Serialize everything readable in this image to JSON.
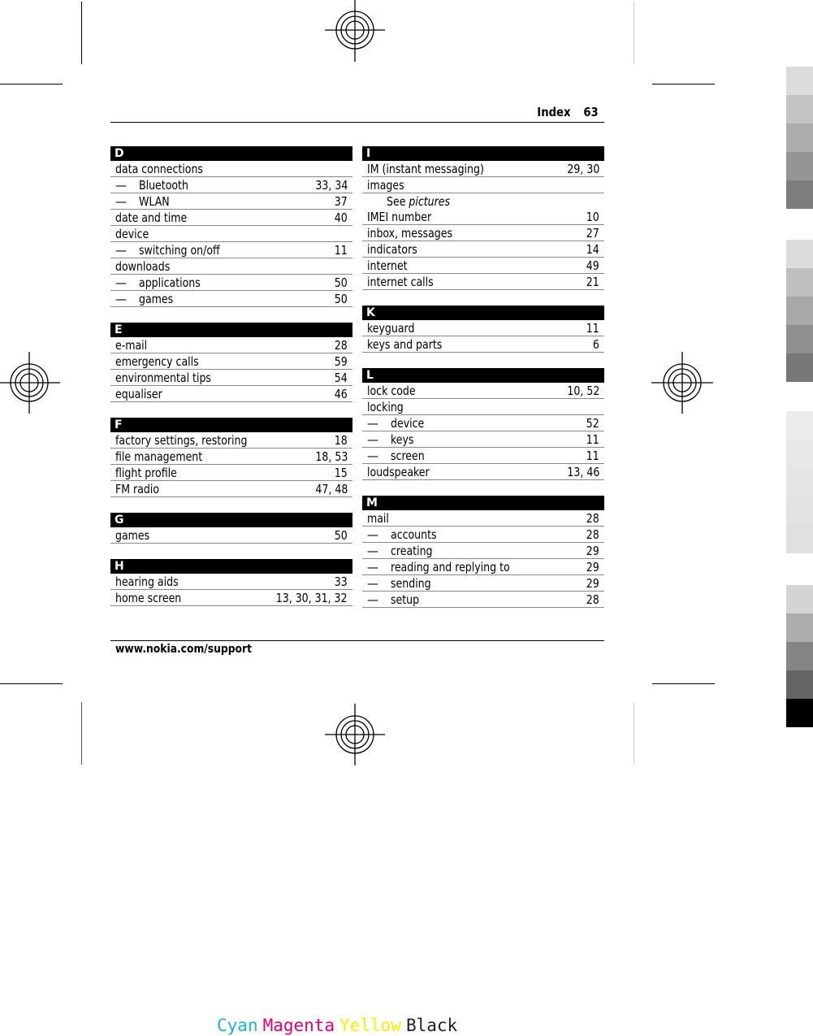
{
  "header": {
    "section": "Index",
    "page_number": "63"
  },
  "footer": {
    "url": "www.nokia.com/support"
  },
  "columns": [
    {
      "sections": [
        {
          "letter": "D",
          "entries": [
            {
              "term": "data connections",
              "pages": "",
              "level": 0
            },
            {
              "term": "Bluetooth",
              "pages": "33, 34",
              "level": 1
            },
            {
              "term": "WLAN",
              "pages": "37",
              "level": 1
            },
            {
              "term": "date and time",
              "pages": "40",
              "level": 0
            },
            {
              "term": "device",
              "pages": "",
              "level": 0
            },
            {
              "term": "switching on/off",
              "pages": "11",
              "level": 1
            },
            {
              "term": "downloads",
              "pages": "",
              "level": 0
            },
            {
              "term": "applications",
              "pages": "50",
              "level": 1
            },
            {
              "term": "games",
              "pages": "50",
              "level": 1
            }
          ]
        },
        {
          "letter": "E",
          "entries": [
            {
              "term": "e-mail",
              "pages": "28",
              "level": 0
            },
            {
              "term": "emergency calls",
              "pages": "59",
              "level": 0
            },
            {
              "term": "environmental tips",
              "pages": "54",
              "level": 0
            },
            {
              "term": "equaliser",
              "pages": "46",
              "level": 0
            }
          ]
        },
        {
          "letter": "F",
          "entries": [
            {
              "term": "factory settings, restoring",
              "pages": "18",
              "level": 0
            },
            {
              "term": "file management",
              "pages": "18, 53",
              "level": 0
            },
            {
              "term": "flight profile",
              "pages": "15",
              "level": 0
            },
            {
              "term": "FM radio",
              "pages": "47, 48",
              "level": 0
            }
          ]
        },
        {
          "letter": "G",
          "entries": [
            {
              "term": "games",
              "pages": "50",
              "level": 0
            }
          ]
        },
        {
          "letter": "H",
          "entries": [
            {
              "term": "hearing aids",
              "pages": "33",
              "level": 0
            },
            {
              "term": "home screen",
              "pages": "13, 30, 31, 32",
              "level": 0
            }
          ]
        }
      ]
    },
    {
      "sections": [
        {
          "letter": "I",
          "entries": [
            {
              "term": "IM (instant messaging)",
              "pages": "29, 30",
              "level": 0
            },
            {
              "term": "images",
              "pages": "",
              "level": 0
            },
            {
              "term": "See",
              "see_target": "pictures",
              "pages": "",
              "level": "see"
            },
            {
              "term": "IMEI number",
              "pages": "10",
              "level": 0
            },
            {
              "term": "inbox, messages",
              "pages": "27",
              "level": 0
            },
            {
              "term": "indicators",
              "pages": "14",
              "level": 0
            },
            {
              "term": "internet",
              "pages": "49",
              "level": 0
            },
            {
              "term": "internet calls",
              "pages": "21",
              "level": 0
            }
          ]
        },
        {
          "letter": "K",
          "entries": [
            {
              "term": "keyguard",
              "pages": "11",
              "level": 0
            },
            {
              "term": "keys and parts",
              "pages": "6",
              "level": 0
            }
          ]
        },
        {
          "letter": "L",
          "entries": [
            {
              "term": "lock code",
              "pages": "10, 52",
              "level": 0
            },
            {
              "term": "locking",
              "pages": "",
              "level": 0
            },
            {
              "term": "device",
              "pages": "52",
              "level": 1
            },
            {
              "term": "keys",
              "pages": "11",
              "level": 1
            },
            {
              "term": "screen",
              "pages": "11",
              "level": 1
            },
            {
              "term": "loudspeaker",
              "pages": "13, 46",
              "level": 0
            }
          ]
        },
        {
          "letter": "M",
          "entries": [
            {
              "term": "mail",
              "pages": "28",
              "level": 0
            },
            {
              "term": "accounts",
              "pages": "28",
              "level": 1
            },
            {
              "term": "creating",
              "pages": "29",
              "level": 1
            },
            {
              "term": "reading and replying to",
              "pages": "29",
              "level": 1
            },
            {
              "term": "sending",
              "pages": "29",
              "level": 1
            },
            {
              "term": "setup",
              "pages": "28",
              "level": 1
            }
          ]
        }
      ]
    }
  ],
  "sub_entry_marker": "—",
  "print_marks": {
    "color_bar_top": [
      "#dcdcdc",
      "#c4c4c4",
      "#acacac",
      "#959595",
      "#7d7d7d"
    ],
    "color_bar_mid": [
      "#dcdcdc",
      "#bfbfbf",
      "#a8a8a8",
      "#8f8f8f",
      "#777777"
    ],
    "color_bar_light": [
      "#ececec",
      "#e8e8e8",
      "#e5e5e5",
      "#e3e3e3",
      "#e0e0e0"
    ],
    "color_bar_bottom": [
      "#d4d4d4",
      "#adadad",
      "#858585",
      "#646464",
      "#000000"
    ],
    "separations": [
      {
        "label": "Cyan",
        "color": "#1ab2e8"
      },
      {
        "label": "Magenta",
        "color": "#e5007e"
      },
      {
        "label": "Yellow",
        "color": "#ffed00"
      },
      {
        "label": "Black",
        "color": "#231f20"
      }
    ]
  }
}
